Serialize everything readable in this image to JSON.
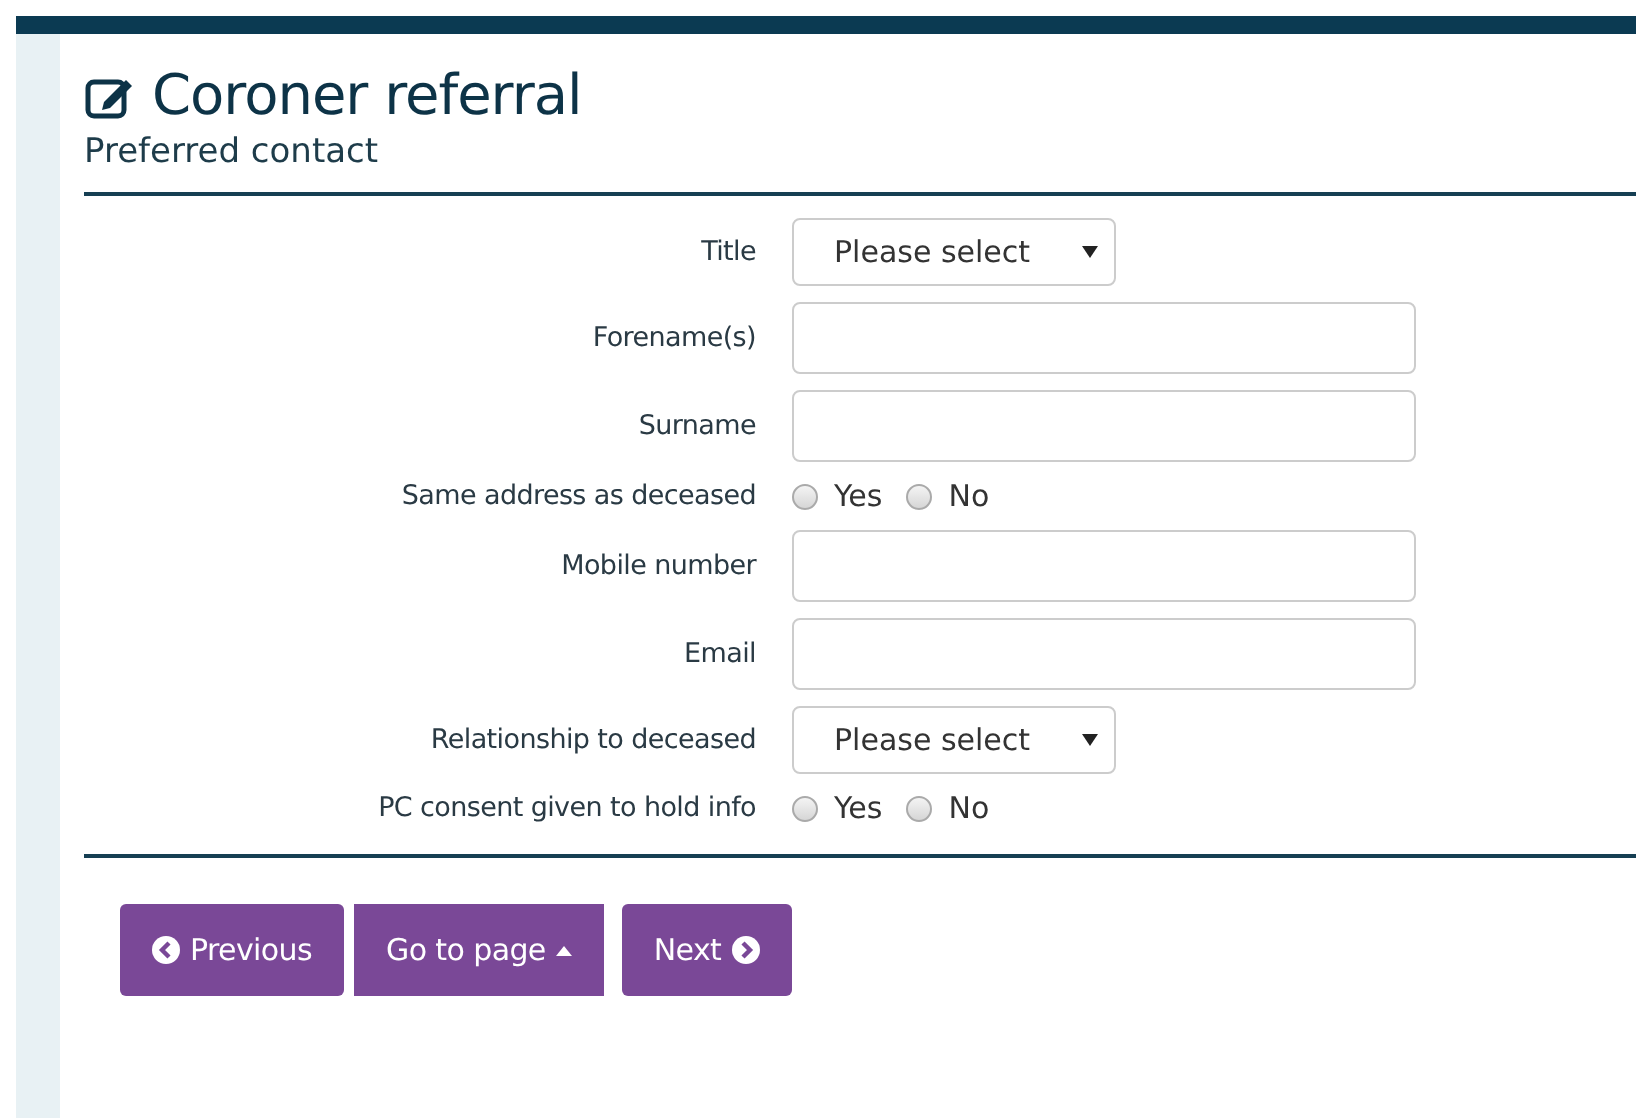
{
  "header": {
    "title": "Coroner referral",
    "subtitle": "Preferred contact"
  },
  "fields": [
    {
      "kind": "select",
      "label": "Title",
      "value": "Please select"
    },
    {
      "kind": "text",
      "label": "Forename(s)"
    },
    {
      "kind": "text",
      "label": "Surname"
    },
    {
      "kind": "radio",
      "label": "Same address as deceased",
      "options": [
        {
          "label": "Yes",
          "selected": false
        },
        {
          "label": "No",
          "selected": false
        }
      ]
    },
    {
      "kind": "text",
      "label": "Mobile number"
    },
    {
      "kind": "text",
      "label": "Email"
    },
    {
      "kind": "select",
      "label": "Relationship to deceased",
      "value": "Please select"
    },
    {
      "kind": "radio",
      "label": "PC consent given to hold info",
      "options": [
        {
          "label": "Yes",
          "selected": false
        },
        {
          "label": "No",
          "selected": false
        }
      ]
    }
  ],
  "buttons": [
    {
      "kind": "previous",
      "label": "Previous"
    },
    {
      "kind": "menu",
      "label": "Go to page"
    },
    {
      "kind": "next",
      "label": "Next"
    }
  ]
}
